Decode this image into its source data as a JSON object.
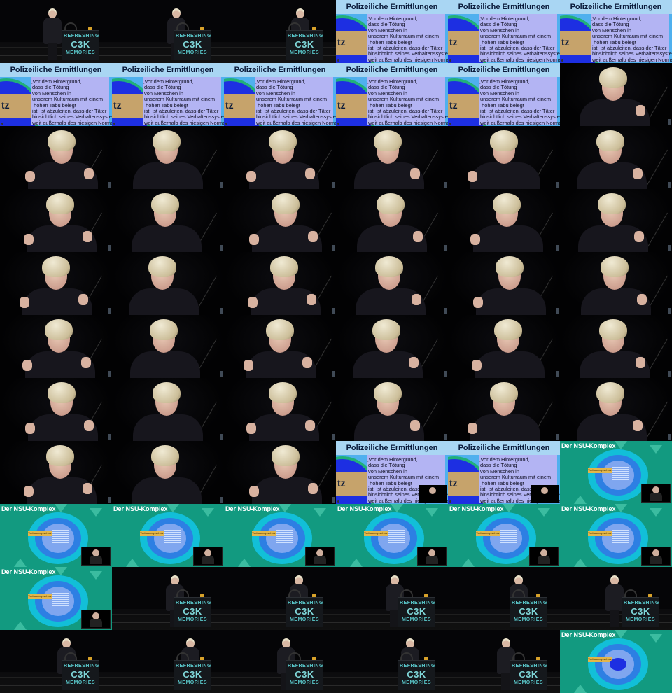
{
  "podium": {
    "line1": "REFRESHING",
    "line2": "C3K",
    "line3": "MEMORIES"
  },
  "police_slide": {
    "title": "Polizeiliche Ermittlungen",
    "side_label": "tz",
    "quote": "„Vor dem Hintergrund,\n dass die Tötung\n von Menschen in\n unserem Kulturraum mit einem\n  hohen Tabu belegt\n ist, ist abzuleiten, dass der Täter\n hinsichtlich seines Verhaltenssystems\n weit außerhalb des hiesigen Normen-\n und Wertesystems verortet ist.“"
  },
  "nsu_slide": {
    "title": "Der NSU-Komplex",
    "tag": "Verfassungsschutz"
  },
  "colors": {
    "police_bg": "#4fb0ee",
    "nsu_bg": "#129a80",
    "podium_text": "#59c6c9"
  },
  "tiles": [
    "stage",
    "stage",
    "stage",
    "police",
    "police",
    "police",
    "police",
    "police",
    "police",
    "police",
    "police",
    "close",
    "close",
    "close",
    "close",
    "close",
    "close",
    "close",
    "close",
    "close",
    "close",
    "close",
    "close",
    "close",
    "close",
    "close",
    "close",
    "close",
    "close",
    "close",
    "close",
    "close",
    "close",
    "close",
    "close",
    "close",
    "close",
    "close",
    "close",
    "close",
    "close",
    "close",
    "close",
    "close",
    "close",
    "police-pip",
    "police-pip",
    "nsu",
    "nsu",
    "nsu",
    "nsu",
    "nsu",
    "nsu",
    "nsu",
    "nsu",
    "stage",
    "stage",
    "stage",
    "stage",
    "stage",
    "stage",
    "stage",
    "stage",
    "stage",
    "stage",
    "nsu-final"
  ]
}
